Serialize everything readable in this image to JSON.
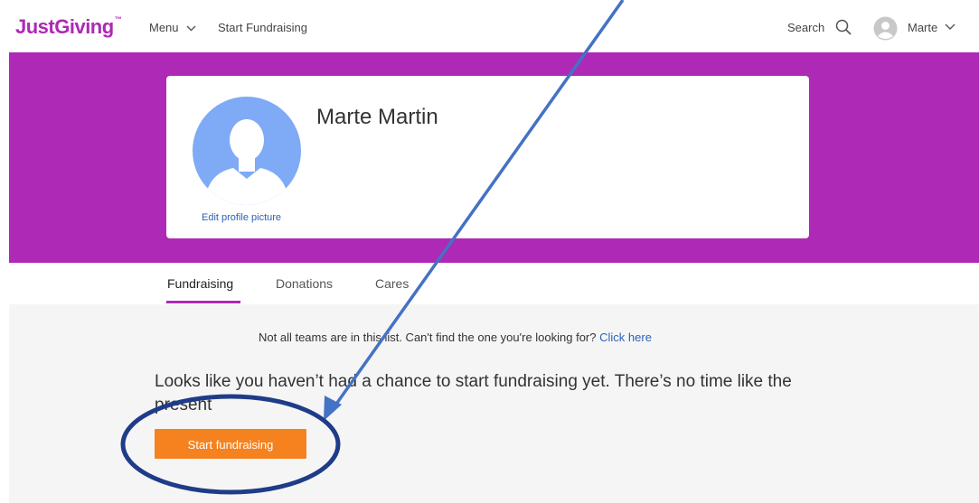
{
  "header": {
    "logo": "JustGiving",
    "logo_tm": "™",
    "menu_label": "Menu",
    "start_fundraising_label": "Start Fundraising",
    "search_label": "Search",
    "user_label": "Marte"
  },
  "profile": {
    "name": "Marte Martin",
    "edit_picture_label": "Edit profile picture"
  },
  "tabs": [
    {
      "label": "Fundraising",
      "active": true
    },
    {
      "label": "Donations",
      "active": false
    },
    {
      "label": "Cares",
      "active": false
    }
  ],
  "main": {
    "notice_text": "Not all teams are in this list. Can't find the one you're looking for?",
    "notice_link": "Click here",
    "headline": "Looks like you haven’t had a chance to start fundraising yet. There’s no time like the present",
    "cta_label": "Start fundraising"
  },
  "colors": {
    "brand_purple": "#ad29b6",
    "cta_orange": "#f5821f",
    "link_blue": "#2a63b8",
    "annotation_blue": "#4472c4",
    "annotation_navy": "#1f3c88"
  },
  "icons": [
    "search-icon",
    "user-avatar-icon",
    "chevron-down-icon",
    "profile-placeholder-icon"
  ]
}
